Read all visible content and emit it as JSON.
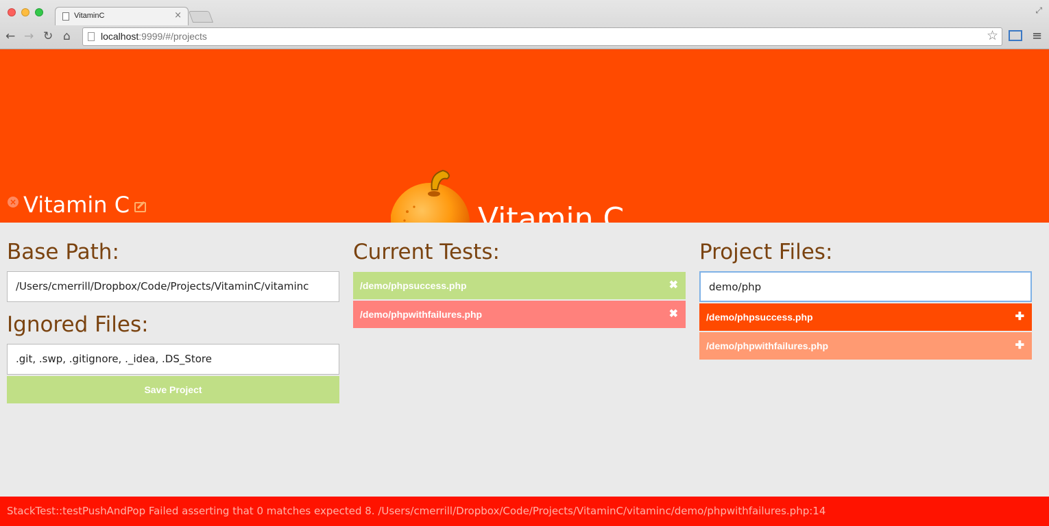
{
  "browser": {
    "tab_title": "VitaminC",
    "url_host": "localhost",
    "url_rest": ":9999/#/projects"
  },
  "header": {
    "project_name": "Vitamin C",
    "logo_text": "Vitamin C"
  },
  "base_path": {
    "heading": "Base Path:",
    "value": "/Users/cmerrill/Dropbox/Code/Projects/VitaminC/vitaminc"
  },
  "ignored_files": {
    "heading": "Ignored Files:",
    "value": ".git, .swp, .gitignore, ._idea, .DS_Store"
  },
  "save_label": "Save Project",
  "current_tests": {
    "heading": "Current Tests:",
    "items": [
      {
        "path": "/demo/phpsuccess.php",
        "status": "pass",
        "color": "#c0df86"
      },
      {
        "path": "/demo/phpwithfailures.php",
        "status": "fail",
        "color": "#ff817c"
      }
    ]
  },
  "project_files": {
    "heading": "Project Files:",
    "search_value": "demo/php",
    "items": [
      {
        "path": "/demo/phpsuccess.php",
        "color": "#ff4a00"
      },
      {
        "path": "/demo/phpwithfailures.php",
        "color": "#ff9a72"
      }
    ]
  },
  "status_message": "StackTest::testPushAndPop Failed asserting that 0 matches expected 8. /Users/cmerrill/Dropbox/Code/Projects/VitaminC/vitaminc/demo/phpwithfailures.php:14",
  "colors": {
    "header": "#ff4a00",
    "heading": "#7a4310",
    "status_bar": "#ff1300"
  }
}
